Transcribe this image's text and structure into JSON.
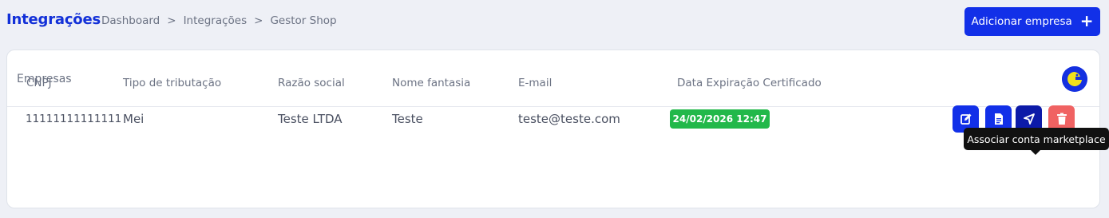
{
  "header": {
    "title": "Integrações",
    "breadcrumb": [
      "Dashboard",
      "Integrações",
      "Gestor Shop"
    ],
    "breadcrumb_separator": ">",
    "add_button_label": "Adicionar empresa",
    "add_button_icon": "plus-icon"
  },
  "card": {
    "title": "Empresas",
    "logo_icon": "company-logo"
  },
  "table": {
    "columns": [
      "CNPJ",
      "Tipo de tributação",
      "Razão social",
      "Nome fantasia",
      "E-mail",
      "Data Expiração Certificado"
    ],
    "rows": [
      {
        "cnpj": "11111111111111",
        "tipo_tributacao": "Mei",
        "razao_social": "Teste LTDA",
        "nome_fantasia": "Teste",
        "email": "teste@teste.com",
        "data_expiracao": "24/02/2026 12:47"
      }
    ]
  },
  "actions": {
    "edit_icon": "edit-icon",
    "document_icon": "document-icon",
    "associate_icon": "send-icon",
    "delete_icon": "trash-icon",
    "tooltip": "Associar conta marketplace"
  },
  "colors": {
    "primary": "#1230e8",
    "primary_dark": "#0c1aa8",
    "success": "#22b84a",
    "danger": "#f06262",
    "background": "#eef0f6",
    "muted_text": "#6b7283"
  }
}
